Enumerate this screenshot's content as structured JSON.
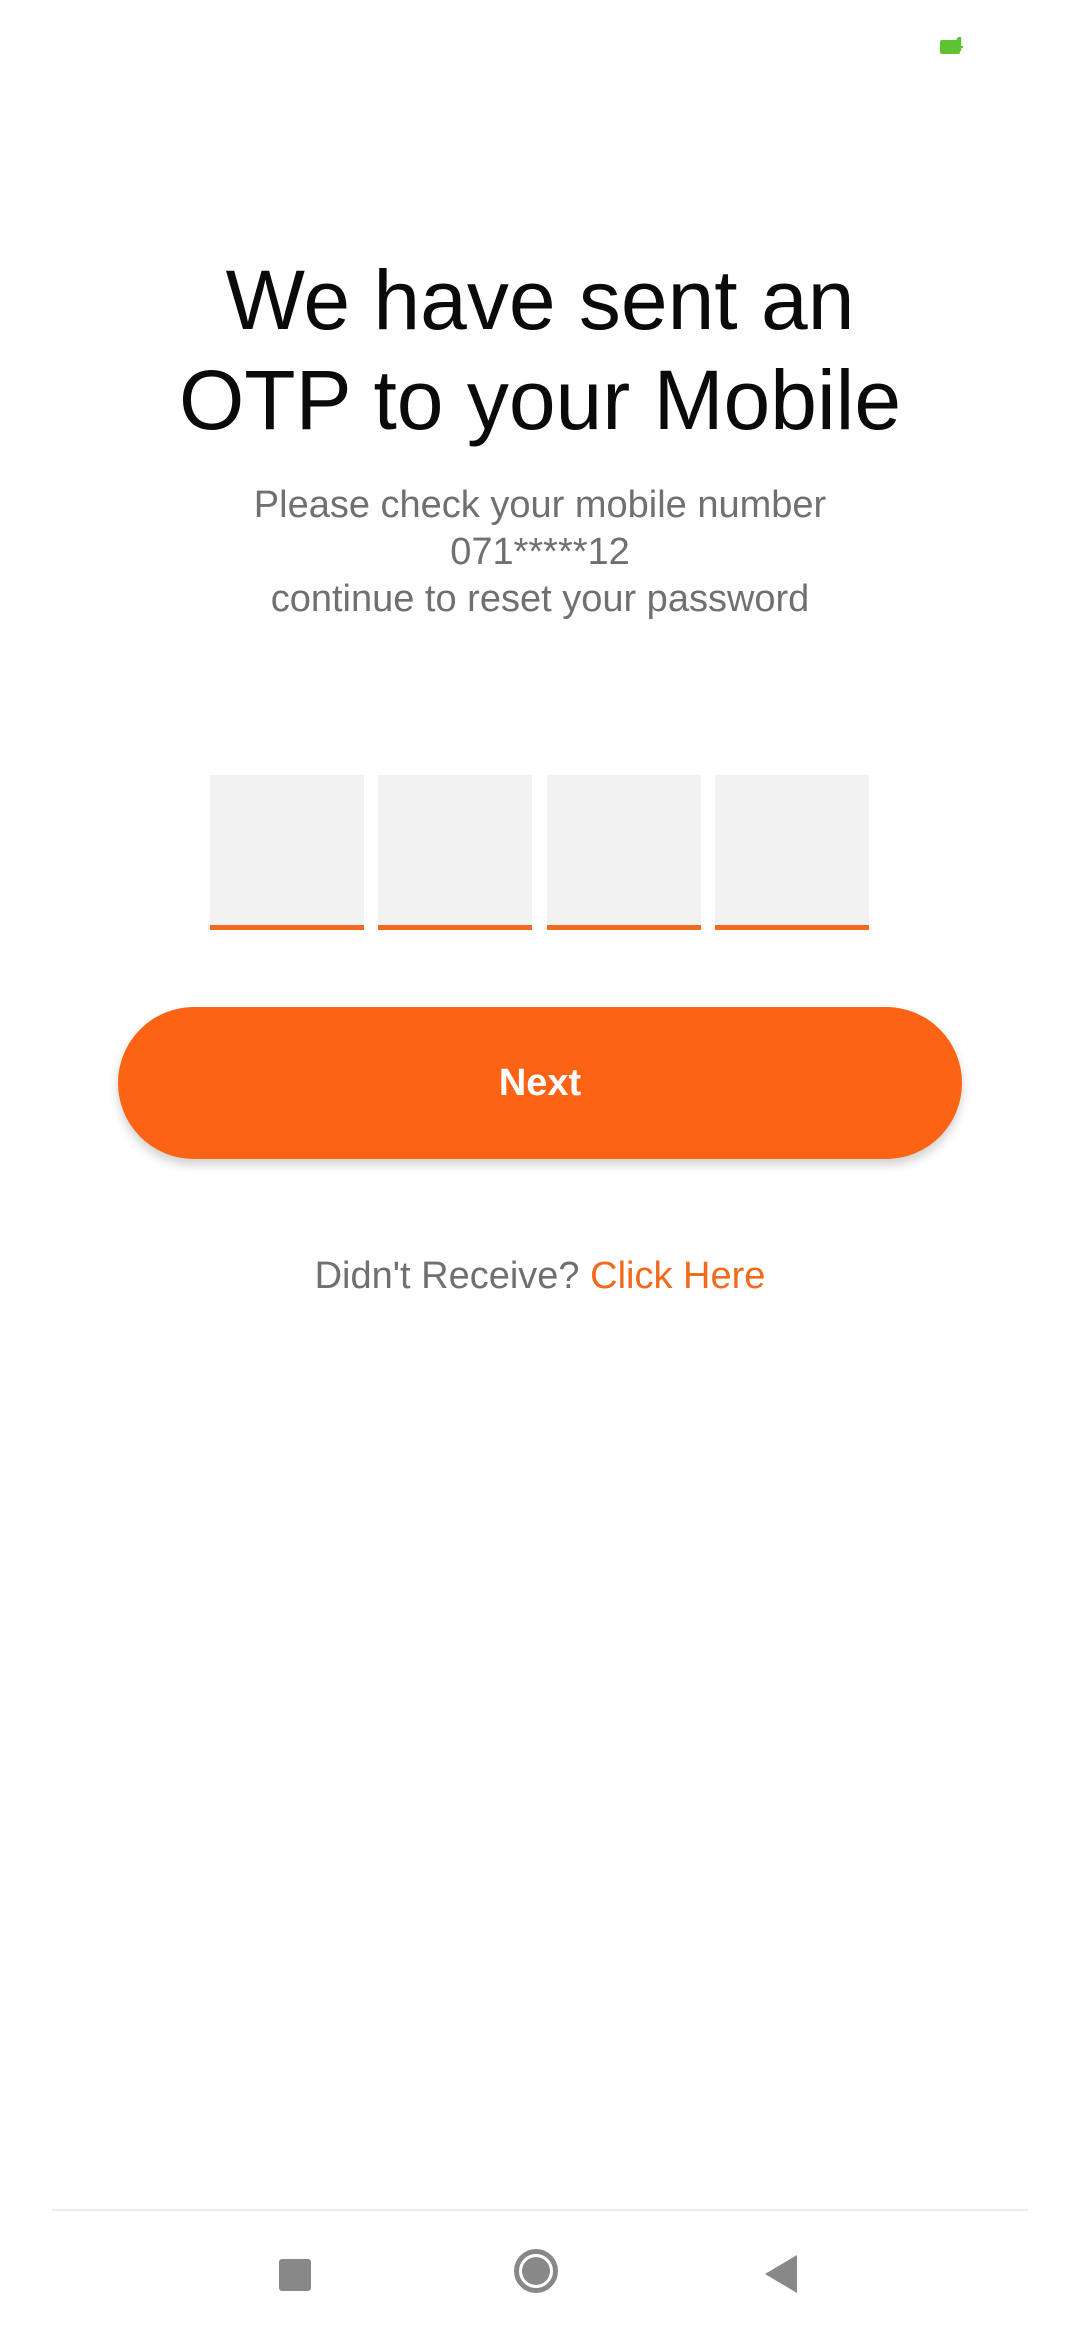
{
  "status_bar": {
    "battery_level": "4",
    "battery_color": "#5ec232"
  },
  "title": {
    "line1": "We have sent an",
    "line2": "OTP to your Mobile"
  },
  "subtitle": {
    "line1": "Please check your mobile number",
    "line2": "071*****12",
    "line3": "continue to reset your password"
  },
  "otp": {
    "digits": [
      "",
      "",
      "",
      ""
    ]
  },
  "next_button": {
    "label": "Next"
  },
  "resend": {
    "prompt": "Didn't Receive?",
    "link": "Click Here"
  },
  "nav_bar": {
    "icons": [
      "recent-apps-icon",
      "home-icon",
      "back-icon"
    ]
  },
  "colors": {
    "accent": "#fd6314",
    "underline": "#f26a1d",
    "text_primary": "#0a0a0a",
    "text_secondary": "#707070",
    "otp_box_bg": "#f2f2f2"
  }
}
